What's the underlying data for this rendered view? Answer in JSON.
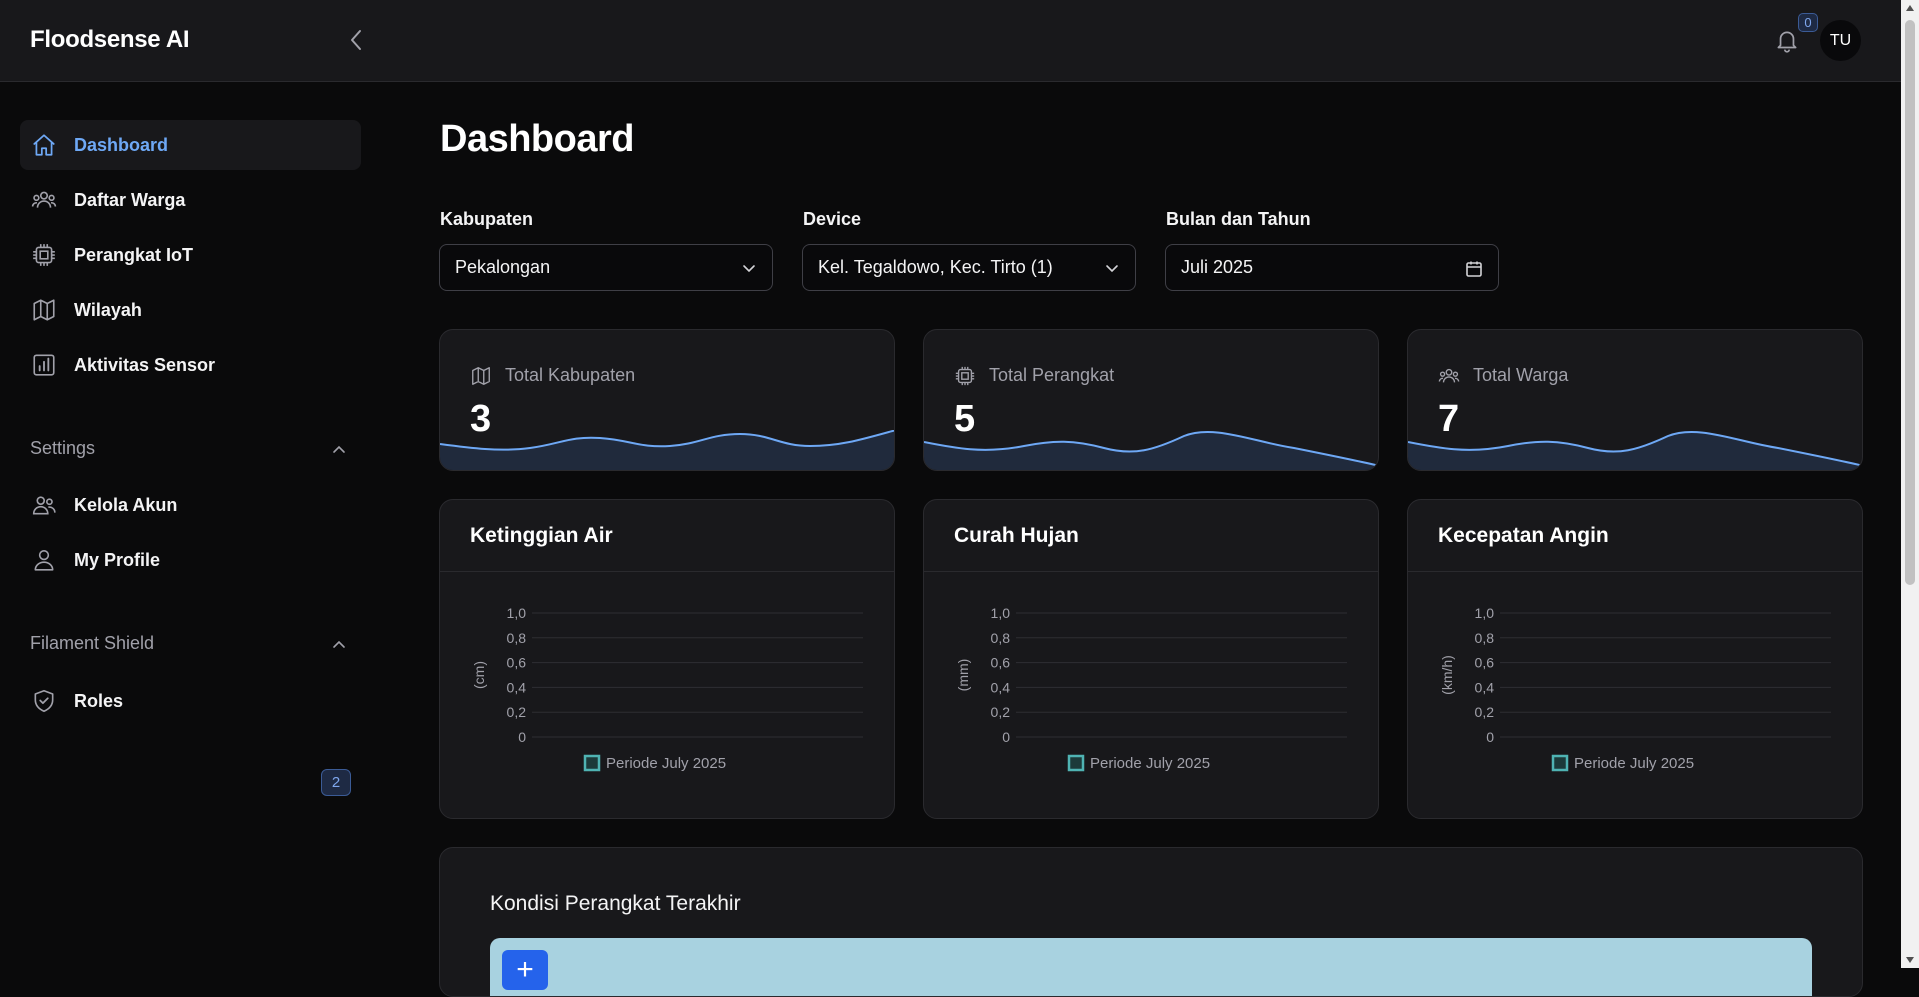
{
  "app": {
    "brand": "Floodsense AI"
  },
  "topbar": {
    "notification_count": "0",
    "avatar_initials": "TU"
  },
  "sidebar": {
    "items": [
      {
        "label": "Dashboard",
        "icon": "home-icon",
        "active": true
      },
      {
        "label": "Daftar Warga",
        "icon": "users-icon"
      },
      {
        "label": "Perangkat IoT",
        "icon": "cpu-chip-icon"
      },
      {
        "label": "Wilayah",
        "icon": "map-icon"
      },
      {
        "label": "Aktivitas Sensor",
        "icon": "bar-chart-icon"
      }
    ],
    "groups": [
      {
        "label": "Settings",
        "items": [
          {
            "label": "Kelola Akun",
            "icon": "users-icon"
          },
          {
            "label": "My Profile",
            "icon": "user-icon"
          }
        ]
      },
      {
        "label": "Filament Shield",
        "items": [
          {
            "label": "Roles",
            "icon": "shield-check-icon",
            "badge": "2"
          }
        ]
      }
    ]
  },
  "page": {
    "title": "Dashboard"
  },
  "filters": {
    "kabupaten": {
      "label": "Kabupaten",
      "value": "Pekalongan"
    },
    "device": {
      "label": "Device",
      "value": "Kel. Tegaldowo, Kec. Tirto (1)"
    },
    "period": {
      "label": "Bulan dan Tahun",
      "value": "Juli 2025"
    }
  },
  "stats": [
    {
      "label": "Total Kabupaten",
      "value": "3",
      "icon": "map-icon"
    },
    {
      "label": "Total Perangkat",
      "value": "5",
      "icon": "cpu-chip-icon"
    },
    {
      "label": "Total Warga",
      "value": "7",
      "icon": "users-icon"
    }
  ],
  "colors": {
    "accent": "#6ea8f5",
    "legend": "#4fb3b3",
    "map": "#a8d2e0",
    "zoom": "#2563eb"
  },
  "chart_data": [
    {
      "type": "line",
      "title": "Ketinggian Air",
      "ylabel": "(cm)",
      "ylim": [
        0,
        1.0
      ],
      "yticks": [
        "1,0",
        "0,8",
        "0,6",
        "0,4",
        "0,2",
        "0"
      ],
      "series": [
        {
          "name": "Periode July 2025",
          "values": []
        }
      ]
    },
    {
      "type": "line",
      "title": "Curah Hujan",
      "ylabel": "(mm)",
      "ylim": [
        0,
        1.0
      ],
      "yticks": [
        "1,0",
        "0,8",
        "0,6",
        "0,4",
        "0,2",
        "0"
      ],
      "series": [
        {
          "name": "Periode July 2025",
          "values": []
        }
      ]
    },
    {
      "type": "line",
      "title": "Kecepatan Angin",
      "ylabel": "(km/h)",
      "ylim": [
        0,
        1.0
      ],
      "yticks": [
        "1,0",
        "0,8",
        "0,6",
        "0,4",
        "0,2",
        "0"
      ],
      "series": [
        {
          "name": "Periode July 2025",
          "values": []
        }
      ]
    }
  ],
  "map_section": {
    "title": "Kondisi Perangkat Terakhir",
    "zoom_in_label": "+"
  }
}
